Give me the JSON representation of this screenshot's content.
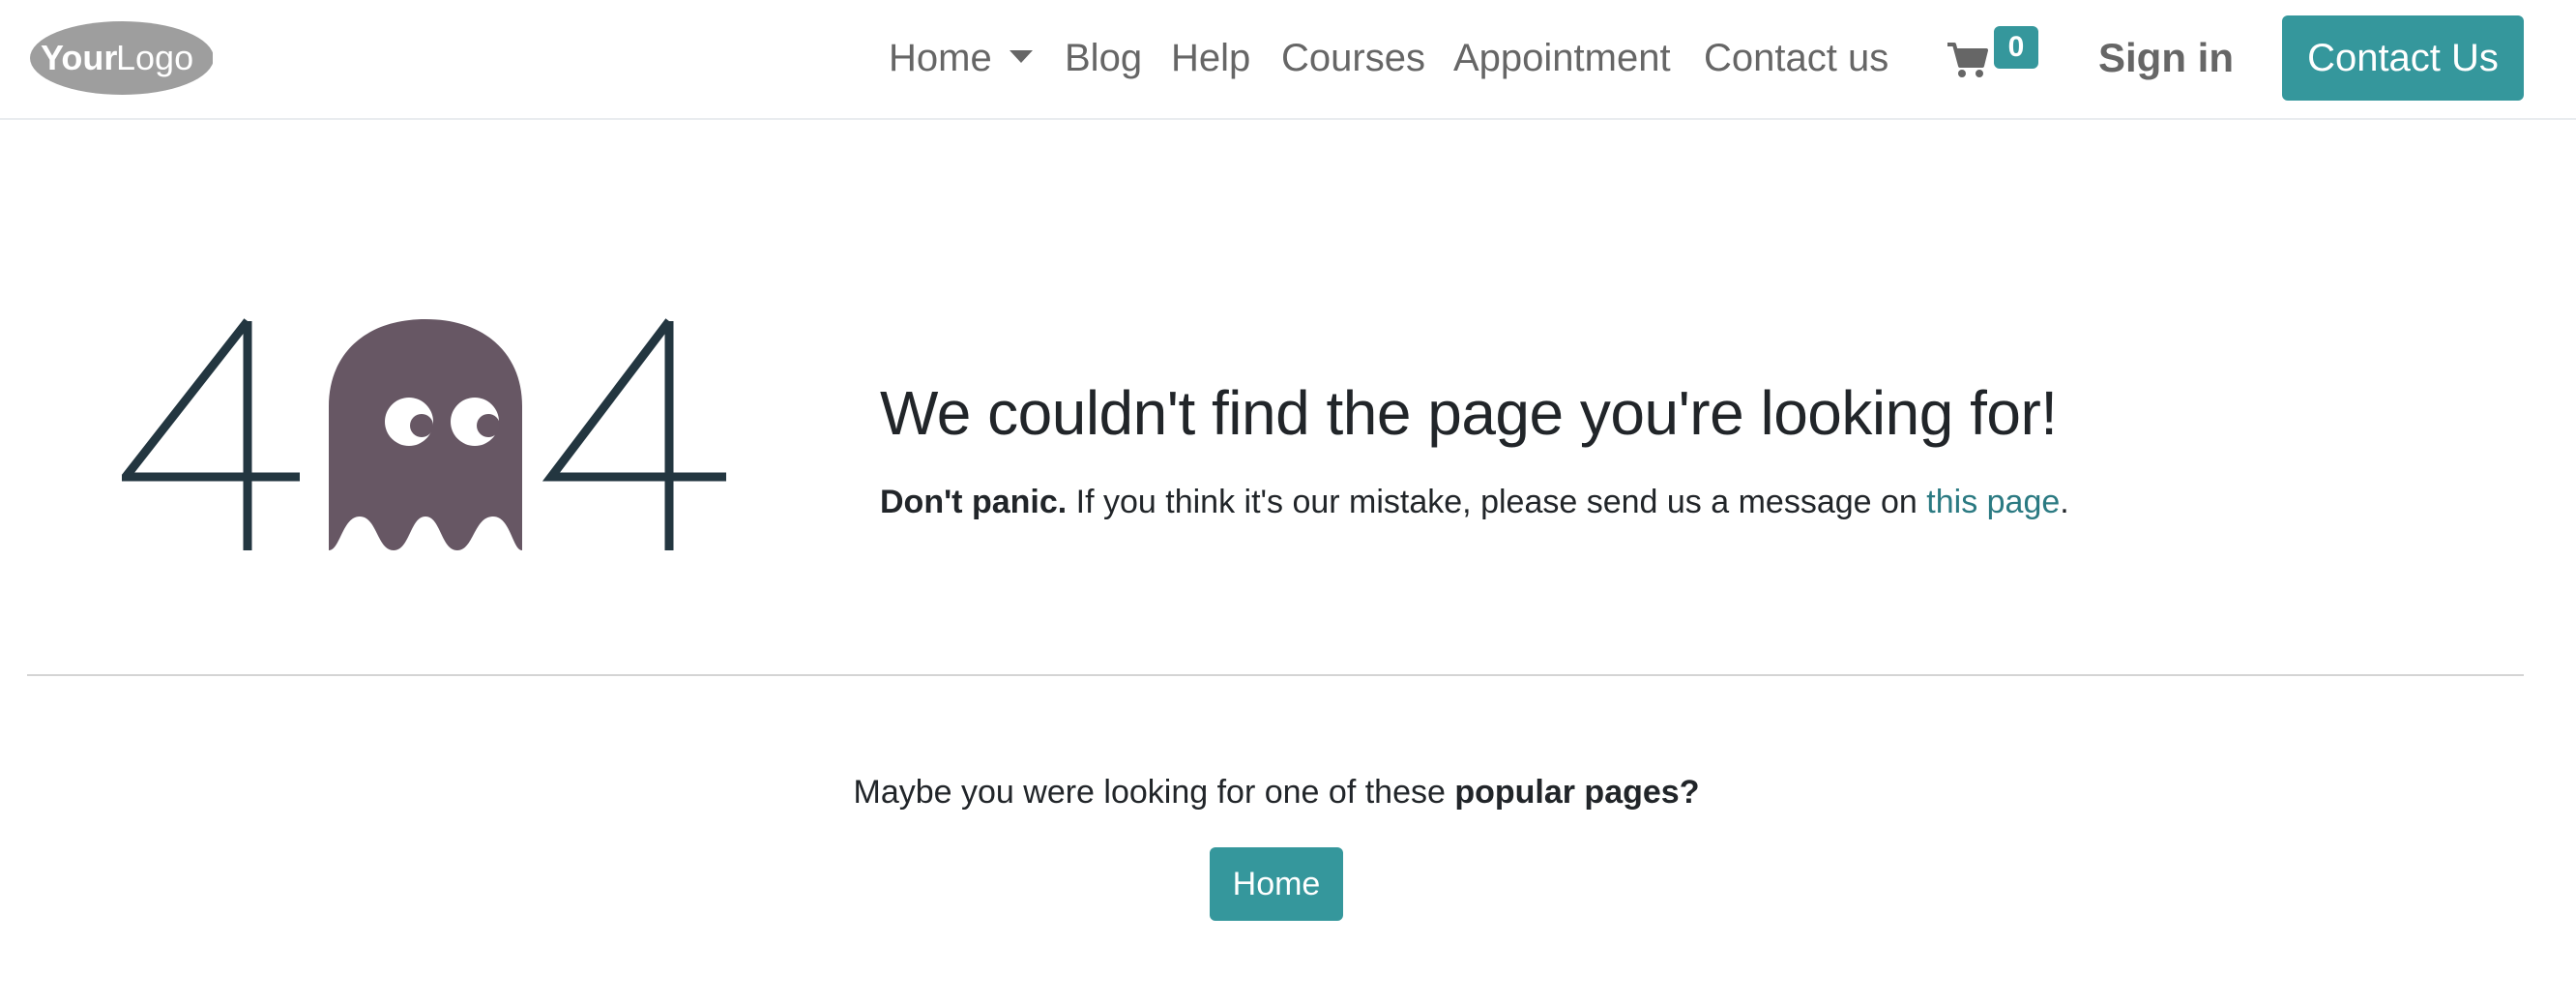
{
  "logo": {
    "text_left": "Your",
    "text_right": "Logo"
  },
  "nav": {
    "items": [
      {
        "label": "Home"
      },
      {
        "label": "Blog"
      },
      {
        "label": "Help"
      },
      {
        "label": "Courses"
      },
      {
        "label": "Appointment"
      },
      {
        "label": "Contact us"
      }
    ],
    "cart_count": "0",
    "sign_in_label": "Sign in",
    "cta_label": "Contact Us"
  },
  "error": {
    "illustration_digits": [
      "4",
      "4"
    ],
    "headline": "We couldn't find the page you're looking for!",
    "message_bold": "Don't panic.",
    "message_text": " If you think it's our mistake, please send us a message on ",
    "message_link": "this page",
    "message_end": "."
  },
  "popular": {
    "intro": "Maybe you were looking for one of these ",
    "intro_bold": "popular pages?",
    "buttons": [
      {
        "label": "Home"
      }
    ]
  },
  "colors": {
    "accent": "#35979c",
    "link": "#2b7a82",
    "ghost": "#675764",
    "digits": "#233640",
    "nav_text": "#666666"
  },
  "icons": {
    "cart": "shopping-cart-icon",
    "caret": "chevron-down-icon"
  }
}
